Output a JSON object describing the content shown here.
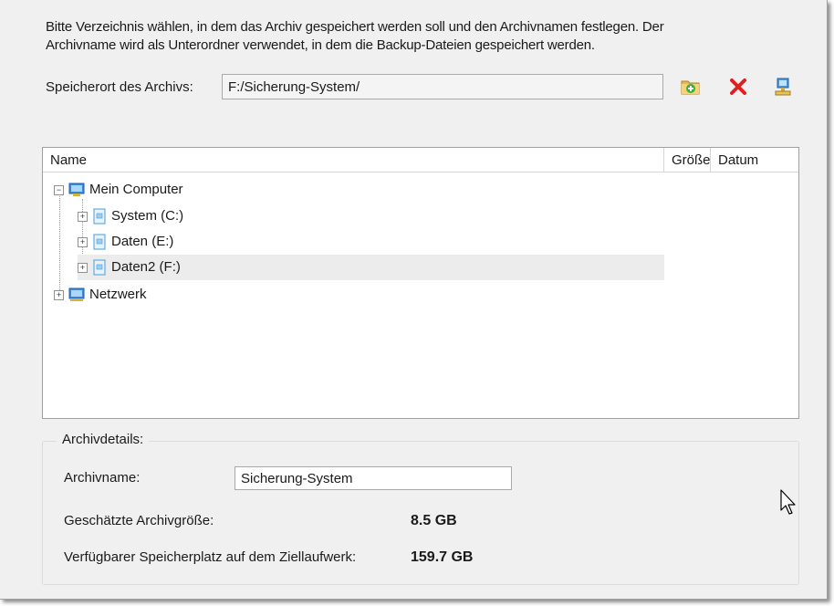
{
  "intro_text": "Bitte Verzeichnis wählen, in dem das Archiv gespeichert werden soll und den Archivnamen festlegen. Der\nArchivname wird als Unterordner verwendet, in dem die Backup-Dateien gespeichert werden.",
  "location": {
    "label": "Speicherort des Archivs:",
    "value": "F:/Sicherung-System/"
  },
  "toolbar": {
    "new_folder_icon": "new-folder-icon",
    "delete_icon": "delete-icon",
    "network_icon": "network-drive-icon",
    "delete_color": "#e02020"
  },
  "tree": {
    "columns": [
      "Name",
      "Größe",
      "Datum"
    ],
    "items": [
      {
        "label": "Mein Computer",
        "icon": "computer-icon",
        "expander": "−"
      },
      {
        "label": "System (C:)",
        "icon": "drive-icon",
        "expander": "+"
      },
      {
        "label": "Daten (E:)",
        "icon": "drive-icon",
        "expander": "+"
      },
      {
        "label": "Daten2 (F:)",
        "icon": "drive-icon",
        "expander": "+",
        "selected": true
      },
      {
        "label": "Netzwerk",
        "icon": "network-icon",
        "expander": "+"
      }
    ]
  },
  "details": {
    "title": "Archivdetails:",
    "name_label": "Archivname:",
    "name_value": "Sicherung-System",
    "size_label": "Geschätzte Archivgröße:",
    "size_value": "8.5 GB",
    "free_label": "Verfügbarer Speicherplatz auf dem Ziellaufwerk:",
    "free_value": "159.7 GB"
  }
}
